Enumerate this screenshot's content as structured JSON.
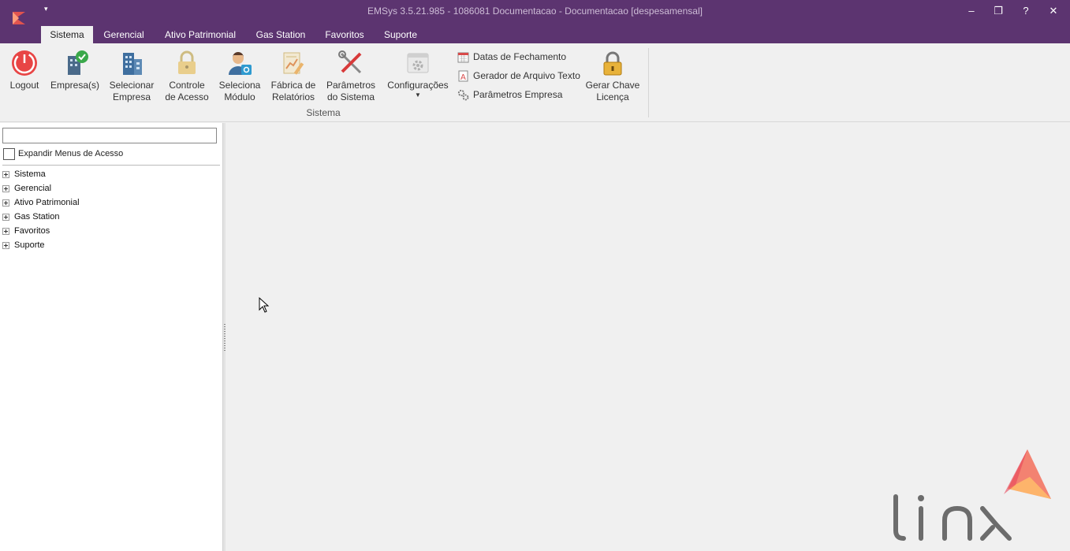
{
  "window": {
    "title": "EMSys 3.5.21.985 - 1086081 Documentacao - Documentacao [despesamensal]",
    "qat_icon": "dropdown-arrow-icon",
    "controls": {
      "minimize": "‒",
      "restore": "❐",
      "help": "?",
      "close": "✕"
    }
  },
  "tabs": [
    "Sistema",
    "Gerencial",
    "Ativo Patrimonial",
    "Gas Station",
    "Favoritos",
    "Suporte"
  ],
  "ribbon": {
    "buttons": [
      {
        "label": "Logout",
        "icon": "power-icon"
      },
      {
        "label": "Empresa(s)",
        "icon": "company-check-icon"
      },
      {
        "label": "Selecionar Empresa",
        "icon": "building-icon"
      },
      {
        "label": "Controle de Acesso",
        "icon": "lock-icon"
      },
      {
        "label": "Seleciona Módulo",
        "icon": "user-module-icon"
      },
      {
        "label": "Fábrica de Relatórios",
        "icon": "report-icon"
      },
      {
        "label": "Parâmetros do Sistema",
        "icon": "tools-icon"
      },
      {
        "label": "Configurações",
        "icon": "settings-window-icon"
      }
    ],
    "small_items": [
      {
        "label": "Datas de Fechamento",
        "icon": "calendar-icon"
      },
      {
        "label": "Gerador de Arquivo Texto",
        "icon": "text-file-icon"
      },
      {
        "label": "Parâmetros Empresa",
        "icon": "gears-icon"
      }
    ],
    "license_button": {
      "label": "Gerar Chave Licença",
      "icon": "padlock-icon"
    },
    "group_label": "Sistema"
  },
  "left_panel": {
    "search_value": "",
    "expand_label": "Expandir Menus de Acesso",
    "tree": [
      "Sistema",
      "Gerencial",
      "Ativo Patrimonial",
      "Gas Station",
      "Favoritos",
      "Suporte"
    ]
  },
  "brand": {
    "logo_text": "linx",
    "primary": "#5c3470",
    "accent": "#f0564a"
  }
}
